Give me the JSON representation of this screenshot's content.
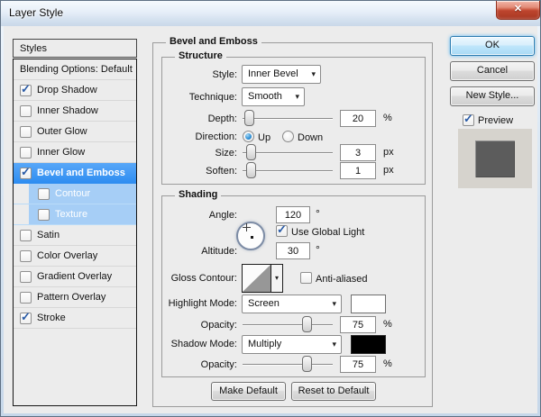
{
  "window": {
    "title": "Layer Style"
  },
  "icons": {
    "close": "✕",
    "dropdown": "▾",
    "check": "✓"
  },
  "colors": {
    "selection_blue": "#2e8df1",
    "sub_selection_blue": "#a6cef6",
    "highlight_swatch": "#ffffff",
    "shadow_swatch": "#000000",
    "ok_focus_glow": "#5eb8f2",
    "dialog_bg": "#ececec"
  },
  "sidebar": {
    "header": "Styles",
    "items": [
      {
        "label": "Blending Options: Default",
        "has_checkbox": false,
        "checked": false,
        "selected": false,
        "sub": false
      },
      {
        "label": "Drop Shadow",
        "has_checkbox": true,
        "checked": true,
        "selected": false,
        "sub": false
      },
      {
        "label": "Inner Shadow",
        "has_checkbox": true,
        "checked": false,
        "selected": false,
        "sub": false
      },
      {
        "label": "Outer Glow",
        "has_checkbox": true,
        "checked": false,
        "selected": false,
        "sub": false
      },
      {
        "label": "Inner Glow",
        "has_checkbox": true,
        "checked": false,
        "selected": false,
        "sub": false
      },
      {
        "label": "Bevel and Emboss",
        "has_checkbox": true,
        "checked": true,
        "selected": true,
        "sub": false
      },
      {
        "label": "Contour",
        "has_checkbox": true,
        "checked": false,
        "selected": false,
        "sub": true
      },
      {
        "label": "Texture",
        "has_checkbox": true,
        "checked": false,
        "selected": false,
        "sub": true
      },
      {
        "label": "Satin",
        "has_checkbox": true,
        "checked": false,
        "selected": false,
        "sub": false
      },
      {
        "label": "Color Overlay",
        "has_checkbox": true,
        "checked": false,
        "selected": false,
        "sub": false
      },
      {
        "label": "Gradient Overlay",
        "has_checkbox": true,
        "checked": false,
        "selected": false,
        "sub": false
      },
      {
        "label": "Pattern Overlay",
        "has_checkbox": true,
        "checked": false,
        "selected": false,
        "sub": false
      },
      {
        "label": "Stroke",
        "has_checkbox": true,
        "checked": true,
        "selected": false,
        "sub": false
      }
    ]
  },
  "panel": {
    "title": "Bevel and Emboss",
    "structure": {
      "title": "Structure",
      "style_label": "Style:",
      "style_value": "Inner Bevel",
      "technique_label": "Technique:",
      "technique_value": "Smooth",
      "depth_label": "Depth:",
      "depth_value": "20",
      "depth_unit": "%",
      "direction_label": "Direction:",
      "direction_up": "Up",
      "direction_down": "Down",
      "direction_selected": "Up",
      "size_label": "Size:",
      "size_value": "3",
      "size_unit": "px",
      "soften_label": "Soften:",
      "soften_value": "1",
      "soften_unit": "px"
    },
    "shading": {
      "title": "Shading",
      "angle_label": "Angle:",
      "angle_value": "120",
      "angle_unit": "°",
      "use_global_light_label": "Use Global Light",
      "use_global_light_checked": true,
      "altitude_label": "Altitude:",
      "altitude_value": "30",
      "altitude_unit": "°",
      "gloss_label": "Gloss Contour:",
      "anti_aliased_label": "Anti-aliased",
      "anti_aliased_checked": false,
      "highlight_label": "Highlight Mode:",
      "highlight_value": "Screen",
      "highlight_color": "#ffffff",
      "opacity1_label": "Opacity:",
      "opacity1_value": "75",
      "opacity1_unit": "%",
      "shadow_label": "Shadow Mode:",
      "shadow_value": "Multiply",
      "shadow_color": "#000000",
      "opacity2_label": "Opacity:",
      "opacity2_value": "75",
      "opacity2_unit": "%"
    },
    "buttons": {
      "make_default": "Make Default",
      "reset_default": "Reset to Default"
    }
  },
  "actions": {
    "ok": "OK",
    "cancel": "Cancel",
    "new_style": "New Style...",
    "preview_label": "Preview",
    "preview_checked": true
  }
}
